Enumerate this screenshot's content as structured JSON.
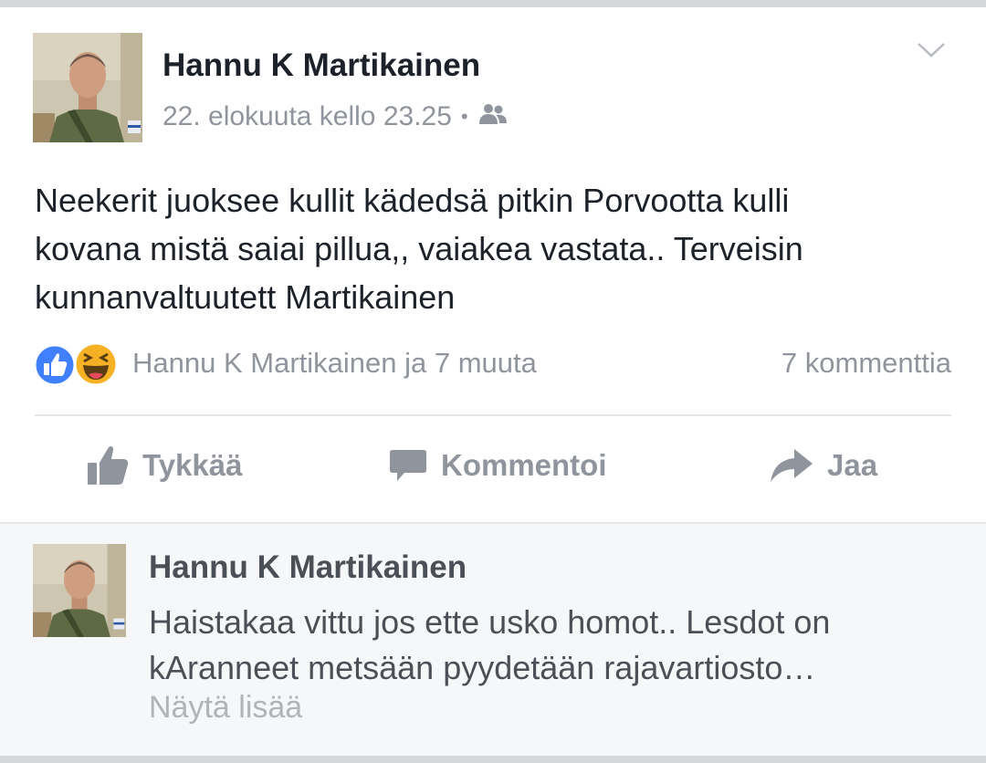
{
  "post": {
    "author": "Hannu K Martikainen",
    "timestamp": "22. elokuuta kello 23.25",
    "meta_separator": "•",
    "audience_icon": "friends-icon",
    "menu_icon": "chevron-down-icon",
    "text_lines": [
      "Neekerit juoksee kullit kädedsä pitkin Porvootta kulli",
      "kovana mistä saiai pillua,, vaiakea vastata.. Terveisin",
      "kunnanvaltuutett Martikainen"
    ],
    "reactions": {
      "types": [
        "like",
        "haha"
      ],
      "summary": "Hannu K Martikainen ja 7 muuta"
    },
    "comment_count": "7 kommenttia",
    "actions": {
      "like_label": "Tykkää",
      "comment_label": "Kommentoi",
      "share_label": "Jaa"
    }
  },
  "comment": {
    "author": "Hannu K Martikainen",
    "text_lines": [
      "Haistakaa vittu jos ette usko homot.. Lesdot on",
      "kAranneet metsään pyydetään rajavartiosto…"
    ],
    "show_more_label": "Näytä lisää"
  },
  "colors": {
    "card_bg": "#ffffff",
    "comment_bg": "#f6f7f9",
    "primary_text": "#1d2129",
    "secondary_text": "#90949c",
    "like_blue": "#4080ff",
    "haha_yellow": "#f7b125"
  }
}
